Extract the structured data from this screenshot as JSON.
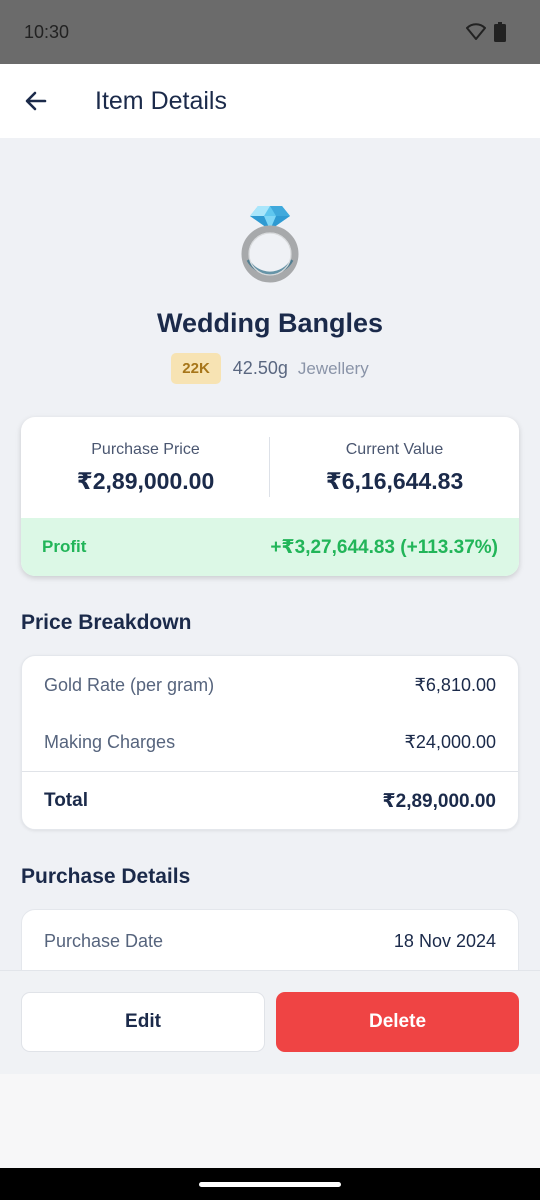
{
  "status_bar": {
    "time": "10:30"
  },
  "header": {
    "title": "Item Details"
  },
  "item": {
    "name": "Wedding Bangles",
    "karat": "22K",
    "weight": "42.50g",
    "category": "Jewellery"
  },
  "value_card": {
    "purchase_label": "Purchase Price",
    "purchase_value": "₹2,89,000.00",
    "current_label": "Current Value",
    "current_value": "₹6,16,644.83",
    "profit_label": "Profit",
    "profit_value": "+₹3,27,644.83 (+113.37%)"
  },
  "price_breakdown": {
    "title": "Price Breakdown",
    "rows": [
      {
        "label": "Gold Rate (per gram)",
        "value": "₹6,810.00"
      },
      {
        "label": "Making Charges",
        "value": "₹24,000.00"
      }
    ],
    "total_label": "Total",
    "total_value": "₹2,89,000.00"
  },
  "purchase_details": {
    "title": "Purchase Details",
    "rows": [
      {
        "label": "Purchase Date",
        "value": "18 Nov 2024"
      }
    ]
  },
  "actions": {
    "edit_label": "Edit",
    "delete_label": "Delete"
  },
  "colors": {
    "primary_text": "#1b2a4a",
    "profit_green": "#22b559",
    "profit_bg": "#dcf8e6",
    "delete_red": "#ef4444",
    "karat_badge_bg": "#f7e3b3",
    "karat_badge_text": "#a7761a"
  },
  "icons": {
    "back": "arrow-left-icon",
    "item": "ring-icon",
    "wifi": "wifi-icon",
    "battery": "battery-icon"
  }
}
